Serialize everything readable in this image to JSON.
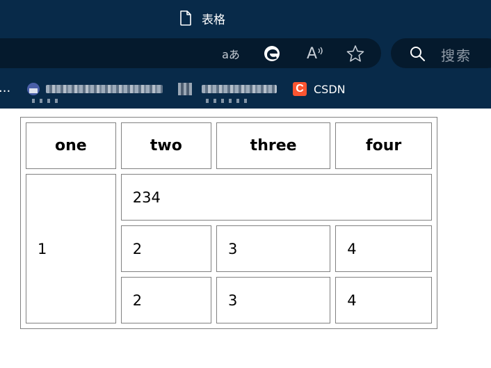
{
  "browser": {
    "tab_title": "表格",
    "toolbar_icons": [
      "read-aloud-translate-icon",
      "edge-icon",
      "read-aloud-icon",
      "favorite-star-icon"
    ],
    "translate_glyph": "aあ",
    "read_aloud_glyph": "A",
    "search_placeholder": "搜索",
    "bookmarks": {
      "overflow": "...",
      "csdn_letter": "C",
      "csdn_label": "CSDN"
    },
    "colors": {
      "chrome_bg": "#082a49",
      "bar_bg": "#051a2d",
      "csdn": "#fc5531"
    }
  },
  "table": {
    "headers": [
      "one",
      "two",
      "three",
      "four"
    ],
    "merged_col1": "1",
    "merged_row": "234",
    "rows": [
      [
        "2",
        "3",
        "4"
      ],
      [
        "2",
        "3",
        "4"
      ]
    ]
  }
}
